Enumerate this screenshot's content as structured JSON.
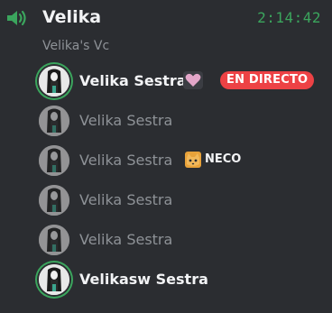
{
  "channel": {
    "name": "Velika",
    "timer": "2:14:42",
    "subtitle": "Velika's Vc",
    "icon": "speaker-icon"
  },
  "members": [
    {
      "name": "Velika Sestra",
      "state": "active",
      "speaking": true,
      "icon": "heart-icon",
      "badge": "EN DIRECTO",
      "badge_color": "#ed4245"
    },
    {
      "name": "Velika Sestra",
      "state": "idle",
      "speaking": false
    },
    {
      "name": "Velika Sestra",
      "state": "idle",
      "speaking": false,
      "activity_icon": "cat-icon",
      "activity": "NECO"
    },
    {
      "name": "Velika Sestra",
      "state": "idle",
      "speaking": false
    },
    {
      "name": "Velika Sestra",
      "state": "idle",
      "speaking": false
    },
    {
      "name": "Velikasw Sestra",
      "state": "active",
      "speaking": true
    }
  ],
  "colors": {
    "background": "#2b2d31",
    "speaking_ring": "#3ba55d",
    "timer": "#3ba55d",
    "muted_text": "#8e9297"
  }
}
